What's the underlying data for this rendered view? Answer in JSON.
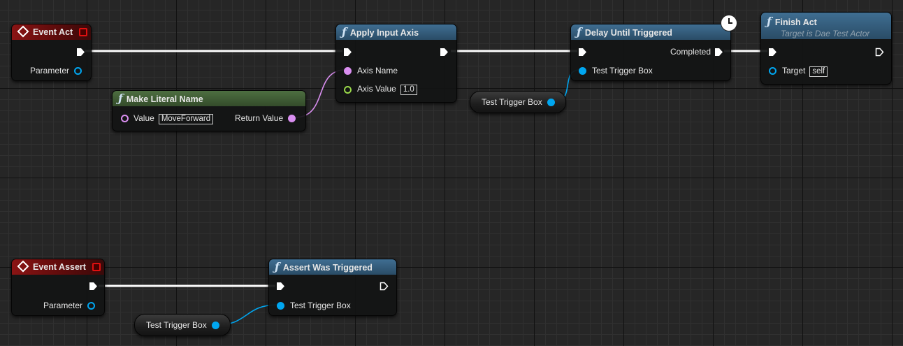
{
  "graph": {
    "event_act": {
      "title": "Event Act",
      "param": "Parameter"
    },
    "make_literal": {
      "title": "Make Literal Name",
      "value_label": "Value",
      "value": "MoveForward",
      "return_label": "Return Value"
    },
    "apply_input": {
      "title": "Apply Input Axis",
      "axis_name": "Axis Name",
      "axis_value_label": "Axis Value",
      "axis_value": "1.0"
    },
    "delay": {
      "title": "Delay Until Triggered",
      "completed": "Completed",
      "trigger_box": "Test Trigger Box"
    },
    "finish": {
      "title": "Finish Act",
      "subtitle": "Target is Dae Test Actor",
      "target_label": "Target",
      "target_value": "self"
    },
    "var1": {
      "label": "Test Trigger Box"
    },
    "event_assert": {
      "title": "Event Assert",
      "param": "Parameter"
    },
    "assert": {
      "title": "Assert Was Triggered",
      "trigger_box": "Test Trigger Box"
    },
    "var2": {
      "label": "Test Trigger Box"
    }
  },
  "colors": {
    "exec_wire": "#ffffff",
    "name_pin": "#d98ef0",
    "float_pin": "#9ad94a",
    "object_pin": "#00a6f0"
  },
  "icons": [
    "event-diamond-icon",
    "function-icon",
    "clock-icon",
    "exec-pin-icon"
  ]
}
